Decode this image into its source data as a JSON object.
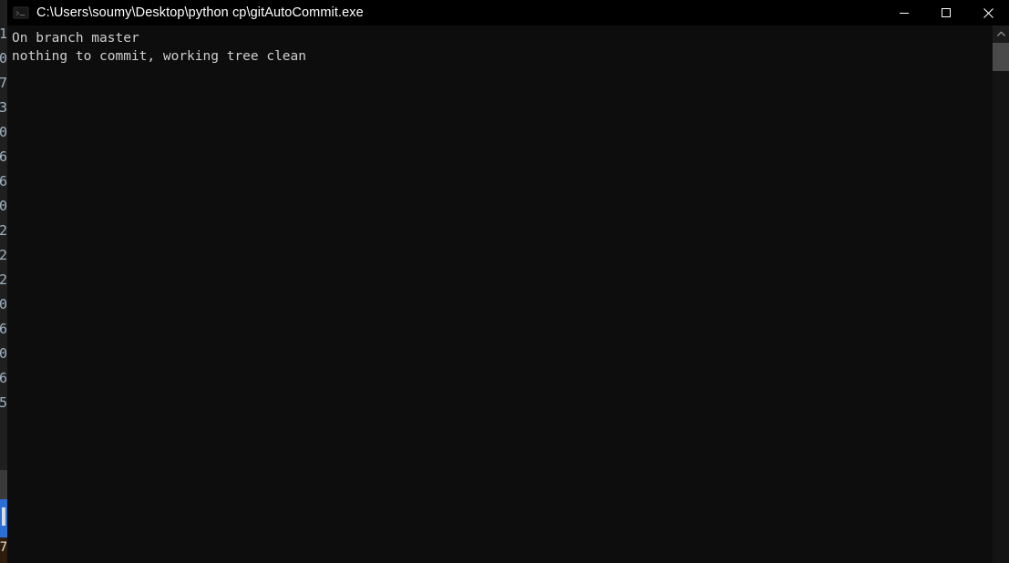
{
  "window": {
    "title": "C:\\Users\\soumy\\Desktop\\python cp\\gitAutoCommit.exe",
    "icon_name": "console-app-icon",
    "titlebar_color": "#000000",
    "console_background": "#0d0d0d",
    "console_foreground": "#cfcfcf",
    "controls": {
      "minimize_label": "Minimize",
      "maximize_label": "Maximize",
      "close_label": "Close"
    }
  },
  "console": {
    "lines": [
      "On branch master",
      "nothing to commit, working tree clean"
    ]
  },
  "scrollbar": {
    "up_arrow_label": "Scroll up",
    "thumb_label": "Scroll thumb",
    "track_label": "Scroll track",
    "thumb_color": "#4a4a4a",
    "track_color": "#141414"
  },
  "background_strip": {
    "digits": [
      "1",
      "0",
      "7",
      "3",
      "0",
      "6",
      "6",
      "0",
      "2",
      "2",
      "2",
      "0",
      "6",
      "0",
      "6",
      "5"
    ],
    "bottom_glyph": "7",
    "accent_color": "#2b6fd4"
  }
}
